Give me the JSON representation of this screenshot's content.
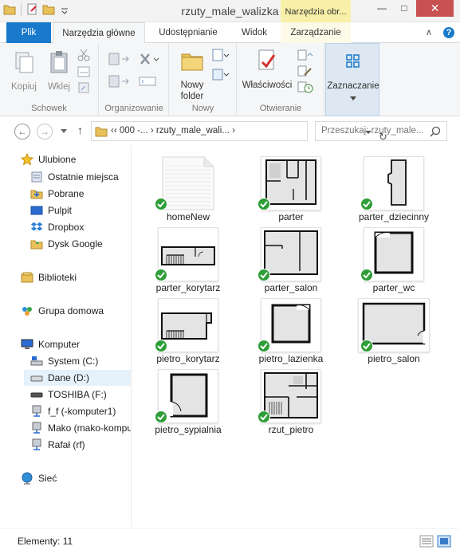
{
  "window": {
    "title": "rzuty_male_walizka",
    "context_tab_header": "Narzędzia obr...",
    "min_glyph": "—",
    "max_glyph": "□",
    "close_glyph": "✕"
  },
  "tabs": {
    "file": "Plik",
    "home": "Narzędzia główne",
    "share": "Udostępnianie",
    "view": "Widok",
    "manage": "Zarządzanie",
    "collapse_glyph": "∧",
    "help_glyph": "?"
  },
  "ribbon": {
    "clipboard": {
      "label": "Schowek",
      "copy": "Kopiuj",
      "paste": "Wklej"
    },
    "organize": {
      "label": "Organizowanie"
    },
    "new": {
      "label": "Nowy",
      "new_folder_line1": "Nowy",
      "new_folder_line2": "folder"
    },
    "open": {
      "label": "Otwieranie",
      "properties": "Właściwości"
    },
    "select": {
      "label": "Zaznaczanie"
    }
  },
  "navbar": {
    "back_glyph": "←",
    "forward_glyph": "→",
    "up_glyph": "↑",
    "path": "‹‹  000 -...  ›  rzuty_male_wali...  ›",
    "refresh_glyph": "↻",
    "search_placeholder": "Przeszukaj: rzuty_male..."
  },
  "navpane": {
    "favorites": "Ulubione",
    "recent": "Ostatnie miejsca",
    "downloads": "Pobrane",
    "desktop": "Pulpit",
    "dropbox": "Dropbox",
    "google_drive": "Dysk Google",
    "libraries": "Biblioteki",
    "homegroup": "Grupa domowa",
    "computer": "Komputer",
    "drive_c": "System (C:)",
    "drive_d": "Dane (D:)",
    "drive_f": "TOSHIBA (F:)",
    "net_f": "f_f (-komputer1)",
    "net_mako": "Mako (mako-kompu",
    "net_rafal": "Rafał (rf)",
    "network": "Sieć"
  },
  "files": [
    {
      "name": "homeNew",
      "kind": "document"
    },
    {
      "name": "parter",
      "kind": "plan"
    },
    {
      "name": "parter_dziecinny",
      "kind": "plan"
    },
    {
      "name": "parter_korytarz",
      "kind": "plan"
    },
    {
      "name": "parter_salon",
      "kind": "plan"
    },
    {
      "name": "parter_wc",
      "kind": "plan"
    },
    {
      "name": "pietro_korytarz",
      "kind": "plan"
    },
    {
      "name": "pietro_lazienka",
      "kind": "plan"
    },
    {
      "name": "pietro_salon",
      "kind": "plan"
    },
    {
      "name": "pietro_sypialnia",
      "kind": "plan"
    },
    {
      "name": "rzut_pietro",
      "kind": "plan"
    }
  ],
  "status": {
    "items": "Elementy: 11"
  },
  "colors": {
    "accent": "#1979ca",
    "check": "#2e9e37",
    "context_tab": "#f8f0a8",
    "close": "#c75050"
  }
}
